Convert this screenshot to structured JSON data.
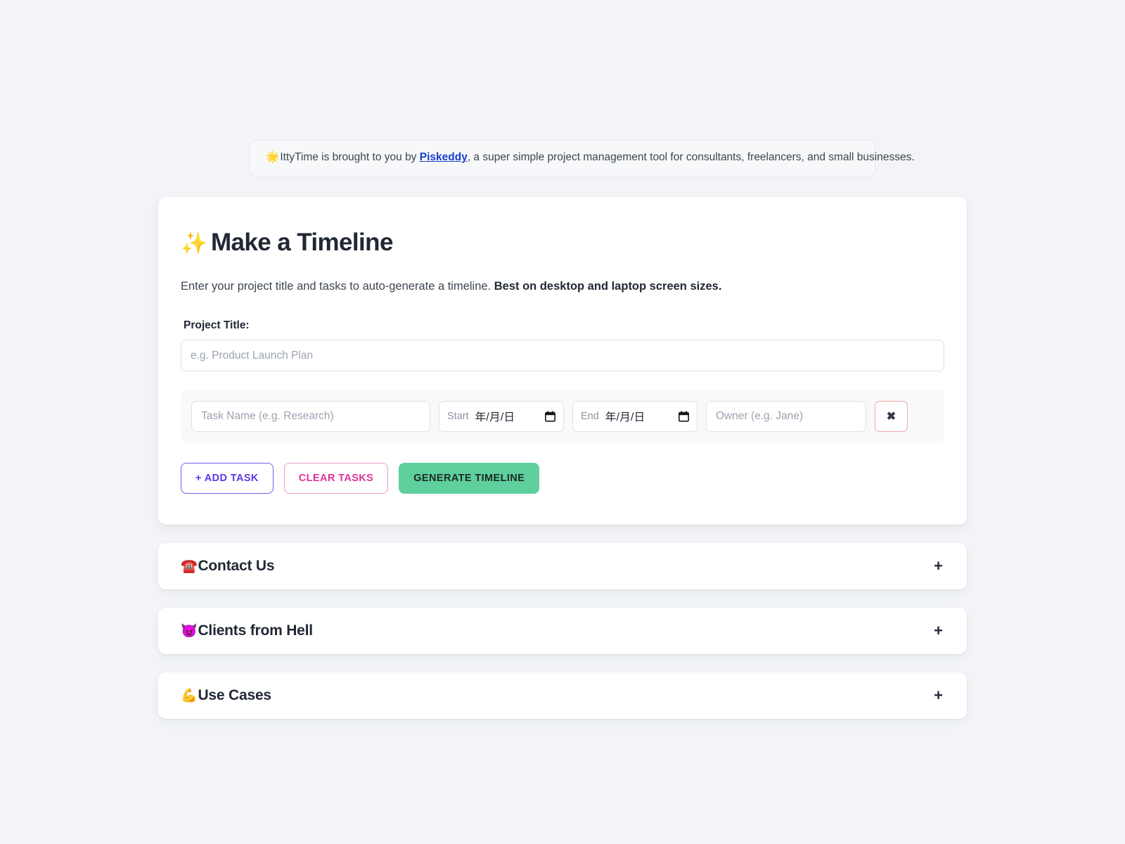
{
  "banner": {
    "emoji": "🌟",
    "text_before": "IttyTime is brought to you by ",
    "link_label": "Piskeddy",
    "text_after": ", a super simple project management tool for consultants, freelancers, and small businesses.",
    "link_color": "#1a3fcc"
  },
  "card": {
    "title_emoji": "✨",
    "title": "Make a Timeline",
    "subtitle_normal": "Enter your project title and tasks to auto-generate a timeline. ",
    "subtitle_bold": "Best on desktop and laptop screen sizes.",
    "project_title_label": "Project Title:",
    "project_title_value": "",
    "project_title_placeholder": "e.g. Product Launch Plan"
  },
  "task_row": {
    "task_name_value": "",
    "task_name_placeholder": "Task Name (e.g. Research)",
    "start_label": "Start",
    "start_value": "年/月/日",
    "end_label": "End",
    "end_value": "年/月/日",
    "owner_value": "",
    "owner_placeholder": "Owner (e.g. Jane)",
    "remove_label": "✖",
    "remove_border_color": "#f0a7a7"
  },
  "actions": {
    "add_task_label": "+ ADD TASK",
    "add_task_color": "#5c38e8",
    "clear_tasks_label": "CLEAR TASKS",
    "clear_tasks_color": "#e0329b",
    "generate_label": "GENERATE TIMELINE",
    "generate_bg": "#5ecf9d"
  },
  "accordions": [
    {
      "emoji": "☎️",
      "label": "Contact Us",
      "toggle": "+"
    },
    {
      "emoji": "😈",
      "label": "Clients from Hell",
      "toggle": "+"
    },
    {
      "emoji": "💪",
      "label": "Use Cases",
      "toggle": "+"
    }
  ],
  "theme": {
    "page_bg": "#f2f4f7",
    "card_bg": "#ffffff",
    "task_row_bg": "#f8f9fb",
    "text": "#212834",
    "muted_text": "#9ba3af"
  }
}
